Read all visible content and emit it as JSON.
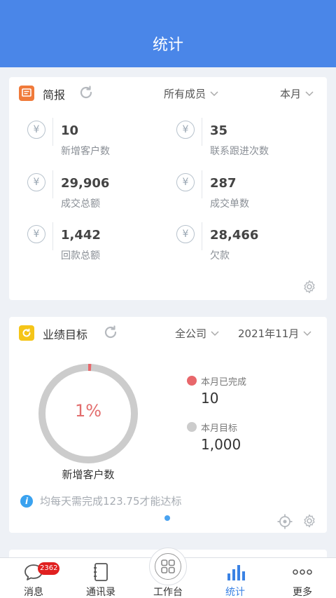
{
  "header": {
    "title": "统计"
  },
  "brief": {
    "title": "简报",
    "member_filter": "所有成员",
    "period_filter": "本月",
    "stats": [
      {
        "value": "10",
        "label": "新增客户数"
      },
      {
        "value": "35",
        "label": "联系跟进次数"
      },
      {
        "value": "29,906",
        "label": "成交总额"
      },
      {
        "value": "287",
        "label": "成交单数"
      },
      {
        "value": "1,442",
        "label": "回款总额"
      },
      {
        "value": "28,466",
        "label": "欠款"
      }
    ]
  },
  "goal": {
    "title": "业绩目标",
    "scope_filter": "全公司",
    "month_filter": "2021年11月",
    "percent_text": "1%",
    "progress_fraction": 0.01,
    "metric_label": "新增客户数",
    "completed_label": "本月已完成",
    "completed_value": "10",
    "target_label": "本月目标",
    "target_value": "1,000",
    "hint": "均每天需完成123.75才能达标",
    "colors": {
      "done": "#e8676b",
      "remaining": "#cccccc"
    }
  },
  "tabbar": {
    "tabs": [
      {
        "label": "消息",
        "badge": "2362"
      },
      {
        "label": "通讯录"
      },
      {
        "label": "工作台"
      },
      {
        "label": "统计"
      },
      {
        "label": "更多"
      }
    ],
    "active_color": "#3a82e4"
  }
}
